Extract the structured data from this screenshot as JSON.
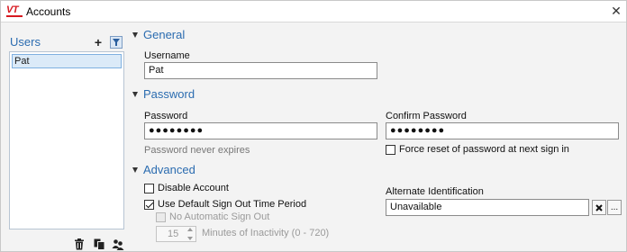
{
  "window": {
    "title": "Accounts",
    "logo_text": "VT",
    "close_icon": "close-icon"
  },
  "users": {
    "label": "Users",
    "add_icon": "plus-icon",
    "filter_icon": "filter-icon",
    "items": [
      {
        "name": "Pat",
        "selected": true
      }
    ],
    "delete_icon": "trash-icon",
    "copy_icon": "copy-icon",
    "group_icon": "users-group-icon"
  },
  "general": {
    "title": "General",
    "username_label": "Username",
    "username_value": "Pat"
  },
  "password": {
    "title": "Password",
    "password_label": "Password",
    "password_value": "●●●●●●●●",
    "confirm_label": "Confirm Password",
    "confirm_value": "●●●●●●●●",
    "never_expires_text": "Password never expires",
    "force_reset_label": "Force reset of password at next sign in",
    "force_reset_checked": false
  },
  "advanced": {
    "title": "Advanced",
    "disable_account_label": "Disable Account",
    "disable_account_checked": false,
    "use_default_signout_label": "Use Default Sign Out Time Period",
    "use_default_signout_checked": true,
    "no_auto_signout_label": "No Automatic Sign Out",
    "no_auto_signout_checked": false,
    "minutes_value": "15",
    "minutes_label": "Minutes of Inactivity (0 - 720)",
    "alt_id_label": "Alternate Identification",
    "alt_id_value": "Unavailable",
    "clear_icon": "clear-x-icon",
    "browse_label": "..."
  },
  "colors": {
    "accent": "#2b6cb0",
    "logo": "#d71920",
    "selection": "#dbeaf8"
  }
}
